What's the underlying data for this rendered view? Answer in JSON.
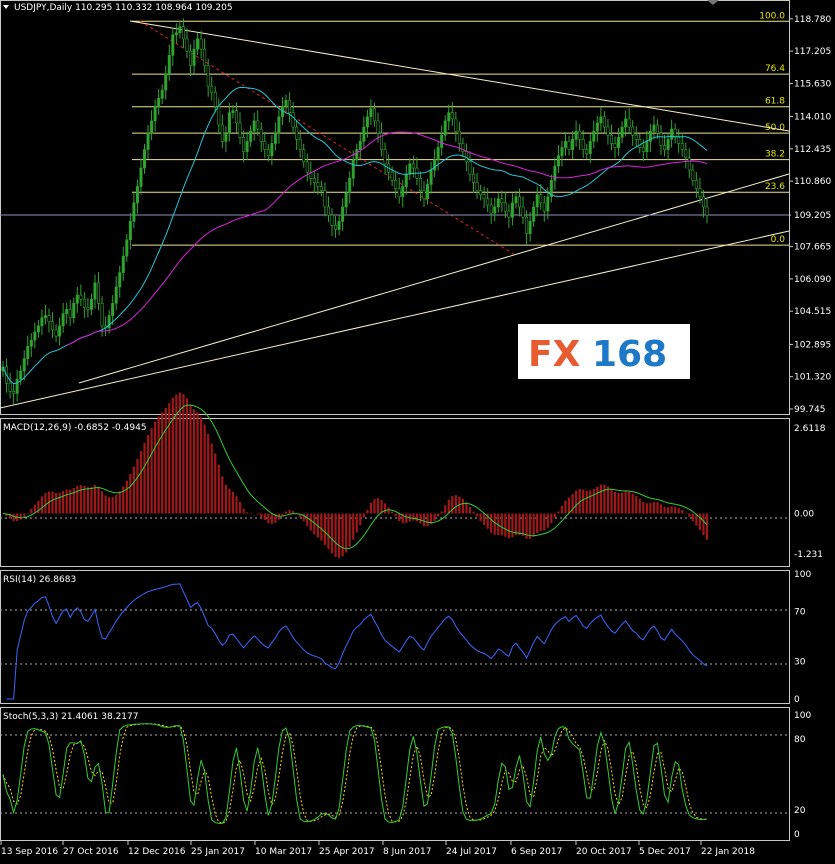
{
  "colors": {
    "background": "#000000",
    "frame": "#c8c8c8",
    "candle": "#2fa42f",
    "trendline": "#f5f0c8",
    "fib": "#f0e68c",
    "fib_label": "#e6e600",
    "ma_cyan": "#22c5d8",
    "ma_magenta": "#dd22dd",
    "dashed_red": "#dd2222",
    "macd_hist": "#a01818",
    "macd_signal": "#32cd32",
    "rsi": "#3a66ff",
    "stoch_main": "#32cd32",
    "stoch_signal": "#ffd700",
    "level_line": "#9090c0",
    "logo_red": "#e85a30",
    "logo_blue": "#1e78c8"
  },
  "main_title": "USDJPY,Daily  110.295 110.332 108.964 109.205",
  "logo": {
    "left": "FX",
    "right": "168"
  },
  "chart_data": [
    {
      "type": "candlestick",
      "title": "USDJPY,Daily  110.295 110.332 108.964 109.205",
      "symbol": "USDJPY",
      "timeframe": "Daily",
      "ohlc_last": {
        "open": 110.295,
        "high": 110.332,
        "low": 108.964,
        "close": 109.205
      },
      "current_price_label": "109.205",
      "y_ticks": [
        "118.780",
        "117.205",
        "115.630",
        "114.010",
        "112.435",
        "110.860",
        "109.205",
        "107.665",
        "106.090",
        "104.515",
        "102.895",
        "101.320",
        "99.745"
      ],
      "ylim": [
        99.5,
        119.6
      ],
      "x_ticks": [
        "13 Sep 2016",
        "27 Oct 2016",
        "12 Dec 2016",
        "25 Jan 2017",
        "10 Mar 2017",
        "25 Apr 2017",
        "8 Jun 2017",
        "24 Jul 2017",
        "6 Sep 2017",
        "20 Oct 2017",
        "5 Dec 2017",
        "22 Jan 2018"
      ],
      "fibonacci_levels": [
        {
          "label": "100.0",
          "price": 118.66
        },
        {
          "label": "76.4",
          "price": 116.08
        },
        {
          "label": "61.8",
          "price": 114.49
        },
        {
          "label": "50.0",
          "price": 113.2
        },
        {
          "label": "38.2",
          "price": 111.91
        },
        {
          "label": "23.6",
          "price": 110.32
        },
        {
          "label": "0.0",
          "price": 107.74
        }
      ],
      "close_series": [
        101.8,
        101.0,
        100.6,
        100.5,
        101.2,
        101.6,
        102.2,
        102.8,
        103.1,
        103.5,
        103.8,
        104.2,
        104.3,
        104.0,
        103.6,
        103.3,
        103.8,
        104.4,
        104.6,
        104.2,
        104.9,
        105.3,
        105.1,
        104.7,
        104.6,
        105.1,
        105.9,
        104.9,
        103.8,
        103.7,
        104.3,
        104.9,
        105.7,
        106.4,
        107.2,
        108.0,
        108.9,
        109.8,
        110.6,
        111.5,
        112.4,
        113.2,
        113.8,
        114.5,
        114.9,
        115.3,
        116.1,
        117.0,
        118.0,
        118.1,
        118.4,
        117.8,
        117.2,
        116.5,
        117.3,
        117.8,
        117.3,
        116.5,
        115.5,
        115.2,
        114.5,
        113.6,
        112.8,
        113.2,
        114.2,
        114.3,
        113.7,
        113.0,
        112.3,
        112.8,
        113.3,
        113.8,
        113.4,
        112.8,
        112.4,
        112.1,
        112.7,
        113.2,
        114.0,
        114.5,
        114.8,
        114.2,
        113.5,
        112.9,
        112.4,
        111.8,
        111.3,
        111.0,
        110.8,
        110.6,
        110.4,
        109.6,
        109.2,
        108.7,
        108.5,
        108.9,
        109.6,
        110.3,
        111.0,
        111.9,
        112.4,
        112.8,
        113.5,
        114.0,
        114.4,
        113.8,
        113.2,
        112.4,
        111.7,
        111.3,
        110.9,
        110.5,
        110.1,
        110.6,
        111.2,
        111.7,
        111.5,
        111.0,
        110.4,
        110.0,
        110.7,
        111.4,
        111.9,
        112.5,
        113.1,
        113.8,
        114.2,
        113.9,
        113.3,
        112.7,
        112.3,
        111.8,
        111.2,
        110.8,
        110.4,
        110.2,
        110.0,
        109.7,
        109.3,
        109.6,
        110.0,
        109.8,
        109.4,
        109.1,
        109.8,
        110.1,
        109.6,
        109.1,
        108.3,
        108.9,
        109.6,
        110.2,
        109.8,
        109.4,
        110.1,
        110.9,
        111.6,
        112.1,
        112.5,
        112.8,
        112.4,
        112.9,
        113.3,
        112.9,
        112.4,
        112.2,
        112.8,
        113.3,
        113.7,
        114.0,
        113.5,
        113.1,
        112.7,
        112.5,
        113.0,
        113.5,
        113.9,
        113.5,
        113.1,
        112.9,
        112.5,
        112.3,
        112.8,
        113.3,
        113.6,
        113.2,
        112.6,
        112.4,
        112.9,
        113.4,
        113.0,
        112.7,
        112.4,
        112.0,
        111.4,
        110.9,
        110.5,
        110.1,
        109.6,
        109.2
      ]
    },
    {
      "type": "line",
      "title": "MACD(12,26,9) -0.6852 -0.4945",
      "parameters": [
        12,
        26,
        9
      ],
      "values": {
        "macd": -0.6852,
        "signal": -0.4945
      },
      "y_ticks": [
        "2.6118",
        "0.00",
        "-1.231"
      ],
      "ylim": [
        -1.6,
        2.85
      ],
      "zero_label": "0.00"
    },
    {
      "type": "line",
      "title": "RSI(14) 26.8683",
      "value": 26.8683,
      "y_ticks": [
        "100",
        "70",
        "30",
        "0"
      ],
      "ylim": [
        0,
        100
      ]
    },
    {
      "type": "line",
      "title": "Stoch(5,3,3) 21.4061 38.2177",
      "parameters": [
        5,
        3,
        3
      ],
      "values": {
        "main": 21.4061,
        "signal": 38.2177
      },
      "y_ticks": [
        "100",
        "80",
        "20",
        "0"
      ],
      "ylim": [
        0,
        100
      ]
    }
  ]
}
